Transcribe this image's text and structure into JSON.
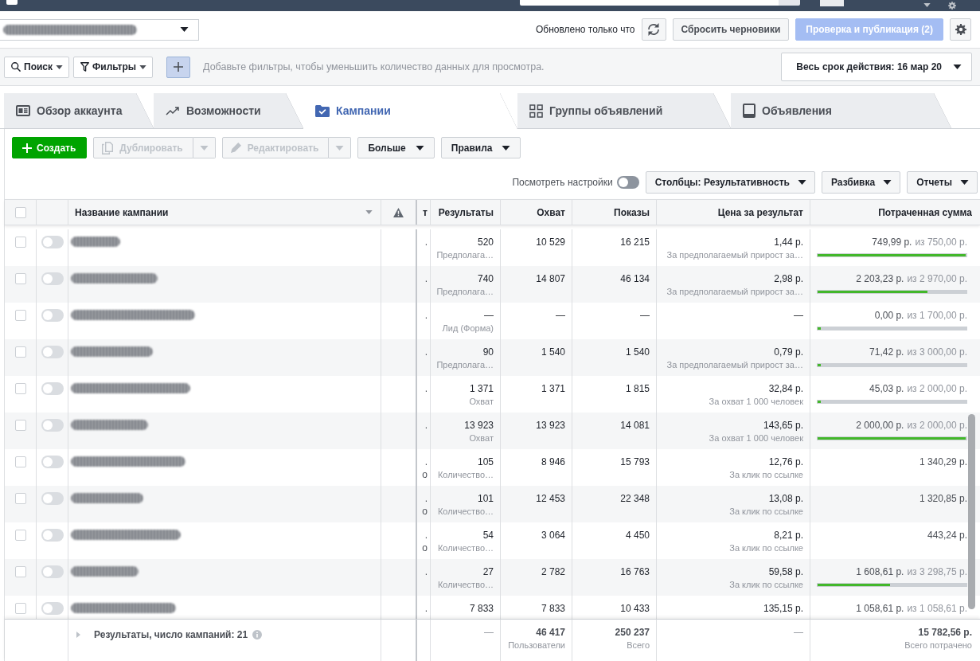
{
  "header": {
    "status": "Обновлено только что",
    "actions": [
      {
        "label": "Сбросить черновики",
        "kind": "secondary",
        "disabled": false
      },
      {
        "label": "Проверка и публикация (2)",
        "kind": "primary",
        "disabled": true
      }
    ]
  },
  "filter_bar": {
    "buttons": [
      {
        "label": "Поиск",
        "kind": "search"
      },
      {
        "label": "Фильтры",
        "kind": "filter"
      }
    ],
    "placeholder": "Добавьте фильтры, чтобы уменьшить количество данных для просмотра.",
    "date_range": "Весь срок действия: 16 мар 20"
  },
  "tabs": [
    {
      "label": "Обзор аккаунта",
      "kind": "overview",
      "selected": false
    },
    {
      "label": "Возможности",
      "kind": "opportunities",
      "selected": false
    },
    {
      "label": "Кампании",
      "kind": "campaigns",
      "selected": true
    },
    {
      "label": "Группы объявлений",
      "kind": "ad_sets",
      "selected": false
    },
    {
      "label": "Объявления",
      "kind": "ads",
      "selected": false
    }
  ],
  "toolbar": {
    "actions": [
      {
        "label": "Создать",
        "kind": "create",
        "disabled": false
      },
      {
        "label": "Дублировать",
        "kind": "duplicate",
        "disabled": true
      },
      {
        "label": "Редактировать",
        "kind": "edit",
        "disabled": true
      },
      {
        "label": "Больше",
        "kind": "menu",
        "disabled": false
      },
      {
        "label": "Правила",
        "kind": "menu",
        "disabled": false
      }
    ],
    "view_settings": {
      "label": "Посмотреть настройки",
      "on": false
    },
    "menus": [
      "Столбцы: Результативность",
      "Разбивка",
      "Отчеты"
    ]
  },
  "table": {
    "select_all": {
      "checked": false
    },
    "name_column": "Название кампании",
    "columns": [
      "т",
      "Результаты",
      "Охват",
      "Показы",
      "Цена за результат",
      "Потраченная сумма"
    ],
    "rows": [
      {
        "checked": false,
        "on": false,
        "column_5": [
          "."
        ],
        "results": "520",
        "result_type": "Предполага…",
        "reach": "10 529",
        "impressions": "16 215",
        "cost": "1,44 р.",
        "cost_type": "За предполагаемый прирост за…",
        "spent": "749,99 р.",
        "budget": "из 750,00 р.",
        "level": 1
      },
      {
        "checked": false,
        "on": false,
        "column_5": [
          "."
        ],
        "results": "740",
        "result_type": "Предполага…",
        "reach": "14 807",
        "impressions": "46 134",
        "cost": "2,98 р.",
        "cost_type": "За предполагаемый прирост за…",
        "spent": "2 203,23 р.",
        "budget": "из 2 970,00 р.",
        "level": 0.74
      },
      {
        "checked": false,
        "on": false,
        "column_5": [
          "."
        ],
        "results": "—",
        "result_type": "Лид (Форма)",
        "reach": "—",
        "impressions": "—",
        "cost": "—",
        "spent": "0,00 р.",
        "budget": "из 1 700,00 р.",
        "level": 0
      },
      {
        "checked": false,
        "on": false,
        "column_5": [
          "."
        ],
        "results": "90",
        "result_type": "Предполага…",
        "reach": "1 540",
        "impressions": "1 540",
        "cost": "0,79 р.",
        "cost_type": "За предполагаемый прирост за…",
        "spent": "71,42 р.",
        "budget": "из 3 000,00 р.",
        "level": 0.024
      },
      {
        "checked": false,
        "on": false,
        "column_5": [
          "."
        ],
        "results": "1 371",
        "result_type": "Охват",
        "reach": "1 371",
        "impressions": "1 815",
        "cost": "32,84 р.",
        "cost_type": "За охват 1 000 человек",
        "spent": "45,03 р.",
        "budget": "из 2 000,00 р.",
        "level": 0.023
      },
      {
        "checked": false,
        "on": false,
        "column_5": [
          "."
        ],
        "results": "13 923",
        "result_type": "Охват",
        "reach": "13 923",
        "impressions": "14 081",
        "cost": "143,65 р.",
        "cost_type": "За охват 1 000 человек",
        "spent": "2 000,00 р.",
        "budget": "из 2 000,00 р.",
        "level": 1
      },
      {
        "checked": false,
        "on": false,
        "column_5": [
          ".",
          "о"
        ],
        "results": "105",
        "result_type": "Количество…",
        "reach": "8 946",
        "impressions": "15 793",
        "cost": "12,76 р.",
        "cost_type": "За клик по ссылке",
        "spent": "1 340,29 р."
      },
      {
        "checked": false,
        "on": false,
        "column_5": [
          ".",
          "о"
        ],
        "results": "101",
        "result_type": "Количество…",
        "reach": "12 453",
        "impressions": "22 348",
        "cost": "13,08 р.",
        "cost_type": "За клик по ссылке",
        "spent": "1 320,85 р."
      },
      {
        "checked": false,
        "on": false,
        "column_5": [
          ".",
          "о"
        ],
        "results": "54",
        "result_type": "Количество…",
        "reach": "3 064",
        "impressions": "4 450",
        "cost": "8,21 р.",
        "cost_type": "За клик по ссылке",
        "spent": "443,24 р."
      },
      {
        "checked": false,
        "on": false,
        "column_5": [
          "."
        ],
        "results": "27",
        "result_type": "Количество…",
        "reach": "2 782",
        "impressions": "16 763",
        "cost": "59,58 р.",
        "cost_type": "За клик по ссылке",
        "spent": "1 608,61 р.",
        "budget": "из 3 298,75 р.",
        "level": 0.49
      },
      {
        "checked": false,
        "on": false,
        "column_5": [
          "."
        ],
        "results": "7 833",
        "reach": "7 833",
        "impressions": "10 433",
        "cost": "135,15 р.",
        "spent": "1 058,61 р.",
        "budget": "из 1 058,61 р."
      }
    ],
    "footer": {
      "expanded": false,
      "summary": "Результаты, число кампаний: 21",
      "results": "—",
      "reach": "46 417",
      "reach_label": "Пользователи",
      "impressions": "250 237",
      "impressions_label": "Всего",
      "cost": "—",
      "spent": "15 782,56 р.",
      "spent_label": "Всего потрачено"
    }
  }
}
